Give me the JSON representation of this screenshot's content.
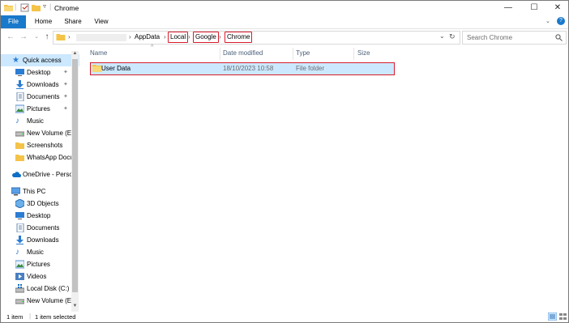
{
  "window": {
    "title": "Chrome"
  },
  "ribbon": {
    "tabs": [
      "File",
      "Home",
      "Share",
      "View"
    ]
  },
  "address": {
    "crumbs": [
      "AppData",
      "Local",
      "Google",
      "Chrome"
    ],
    "search_placeholder": "Search Chrome"
  },
  "sidebar": {
    "items": [
      {
        "label": "Quick access",
        "icon": "star-icon"
      },
      {
        "label": "Desktop",
        "icon": "desktop-icon"
      },
      {
        "label": "Downloads",
        "icon": "download-icon"
      },
      {
        "label": "Documents",
        "icon": "documents-icon"
      },
      {
        "label": "Pictures",
        "icon": "pictures-icon"
      },
      {
        "label": "Music",
        "icon": "music-icon"
      },
      {
        "label": "New Volume (E:)",
        "icon": "drive-icon"
      },
      {
        "label": "Screenshots",
        "icon": "folder-icon"
      },
      {
        "label": "WhatsApp Docu",
        "icon": "folder-icon"
      },
      {
        "label": "OneDrive - Person",
        "icon": "cloud-icon"
      },
      {
        "label": "This PC",
        "icon": "computer-icon"
      },
      {
        "label": "3D Objects",
        "icon": "cube-icon"
      },
      {
        "label": "Desktop",
        "icon": "desktop-icon"
      },
      {
        "label": "Documents",
        "icon": "documents-icon"
      },
      {
        "label": "Downloads",
        "icon": "download-icon"
      },
      {
        "label": "Music",
        "icon": "music-icon"
      },
      {
        "label": "Pictures",
        "icon": "pictures-icon"
      },
      {
        "label": "Videos",
        "icon": "videos-icon"
      },
      {
        "label": "Local Disk (C:)",
        "icon": "drive-icon"
      },
      {
        "label": "New Volume (E:)",
        "icon": "drive-icon"
      }
    ]
  },
  "columns": [
    "Name",
    "Date modified",
    "Type",
    "Size"
  ],
  "files": [
    {
      "name": "User Data",
      "date": "18/10/2023 10:58",
      "type": "File folder",
      "size": ""
    }
  ],
  "status": {
    "count": "1 item",
    "selected": "1 item selected"
  },
  "colors": {
    "accent": "#1979ca",
    "selection": "#cce8ff",
    "highlight": "#d91c2a",
    "folder": "#f4c348"
  }
}
